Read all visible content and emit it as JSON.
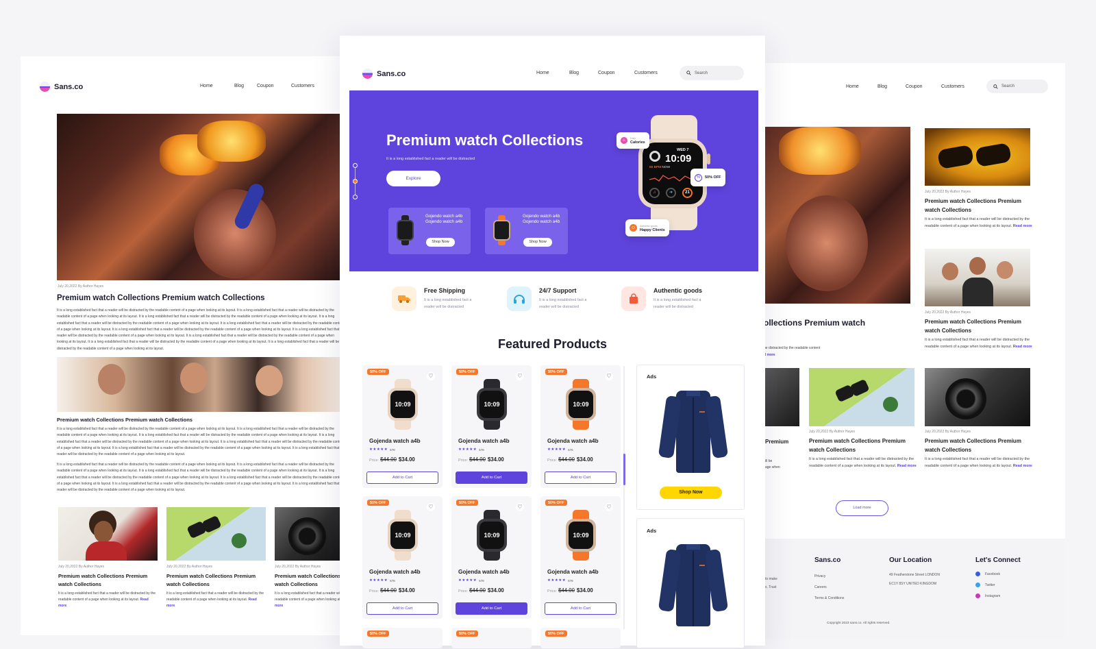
{
  "brand": {
    "name": "Sans.co"
  },
  "nav": {
    "home": "Home",
    "blog": "Blog",
    "coupon": "Coupon",
    "customers": "Customers",
    "search_placeholder": "Search"
  },
  "left": {
    "meta1": "July 20,2022   By Author Hayes",
    "title1": "Premium watch Collections Premium watch Collections",
    "para1": "It is a long established fact that a reader will be distracted by the readable content of a page when looking at its layout.  It is a long established fact that a reader will be distracted by the readable content of a page when looking at its layout.  It is a long established fact that a reader will be distracted by the readable content of a page when looking at its layout.  It is a long established fact that a reader will be distracted by the readable content of a page when looking at its layout. It is a long established fact that a reader will be distracted by the readable content of a page when looking at its layout.  It is a long established fact that a reader will be distracted by the readable content of a page when looking at its layout. It is a long established fact that a reader will be distracted by the readable content of a page when looking at its layout. It is a long established fact that a reader will be distracted by the readable content of a page when looking at its layout. It is a long established fact that a reader will be distracted by the readable content of a page when looking at its layout. It is a long established fact that a reader will be distracted by the readable content of a page when looking at its layout.",
    "subtitle": "Premium watch Collections Premium watch Collections",
    "para2": "It is a long established fact that a reader will be distracted by the readable content of a page when looking at its layout.  It is a long established fact that a reader will be distracted by the readable content of a page when looking at its layout.  It is a long established fact that a reader will be distracted by the readable content of a page when looking at its layout.  It is a long established fact that a reader will be distracted by the readable content of a page when looking at its layout. It is a long established fact that a reader will be distracted by the readable content of a page when looking at its layout.  It is a long established fact that a reader will be distracted by the readable content of a page when looking at its layout. It is a long established fact that a reader will be distracted by the readable content of a page when looking at its layout.",
    "para3": "It is a long established fact that a reader will be distracted by the readable content of a page when looking at its layout.  It is a long established fact that a reader will be distracted by the readable content of a page when looking at its layout.  It is a long established fact that a reader will be distracted by the readable content of a page when looking at its layout.  It is a long established fact that a reader will be distracted by the readable content of a page when looking at its layout. It is a long established fact that a reader will be distracted by the readable content of a page when looking at its layout.  It is a long established fact that a reader will be distracted by the readable content of a page when looking at its layout. It is a long established fact that a reader will be distracted by the readable content of a page when looking at its layout.",
    "cards": [
      {
        "meta": "July 20,2022   By Author Hayes",
        "title": "Premium watch Collections Premium watch Collections",
        "text": "It is a long established fact that a reader will be distracted by the readable content of a page when looking at its layout.",
        "more": "Read more"
      },
      {
        "meta": "July 20,2022   By Author Hayes",
        "title": "Premium watch Collections Premium watch Collections",
        "text": "It is a long established fact that a reader will be distracted by the readable content of a page when looking at its layout.",
        "more": "Read more"
      },
      {
        "meta": "July 20,2022   By Author Hayes",
        "title": "Premium watch Collections Premium watch Collections",
        "text": "It is a long established fact that a reader will be distracted by the readable content of a page when looking at its layout.",
        "more": "Read more"
      }
    ]
  },
  "hero": {
    "title": "Premium watch Collections",
    "subtitle": "It is a long established fact a reader will be distracted",
    "explore": "Explore",
    "mini": [
      {
        "text": "Gojendo watch a4b Gojendo watch a4b",
        "btn": "Shop Now"
      },
      {
        "text": "Gojendo watch a4b Gojendo watch a4b",
        "btn": "Shop Now"
      }
    ],
    "badge_calories_small": "Daily",
    "badge_calories": "Calories",
    "badge_off": "50% OFF",
    "badge_clients_small": "Authentic goods",
    "badge_clients": "Happy Clients",
    "watch": {
      "day": "WED 7",
      "time": "10:09",
      "bpm": "60 BPM",
      "now": "NOW",
      "num": "21"
    }
  },
  "features": [
    {
      "title": "Free Shipping",
      "text": "It is a long established fact a reader will be distracted"
    },
    {
      "title": "24/7 Support",
      "text": "It is a long established fact a reader will be distracted"
    },
    {
      "title": "Authentic goods",
      "text": "It is a long established fact a reader will be distracted"
    }
  ],
  "featured_title": "Featured Products",
  "products": [
    {
      "off": "50% OFF",
      "name": "Gojenda watch a4b",
      "stars": "★★★★★",
      "reviews": "578",
      "price_label": "Price:",
      "old": "$44.00",
      "new": "$34.00",
      "cta": "Add to Cart",
      "color": "cream",
      "filled": false
    },
    {
      "off": "50% OFF",
      "name": "Gojenda watch a4b",
      "stars": "★★★★★",
      "reviews": "578",
      "price_label": "Price:",
      "old": "$44.00",
      "new": "$34.00",
      "cta": "Add to Cart",
      "color": "black",
      "filled": true
    },
    {
      "off": "50% OFF",
      "name": "Gojenda watch a4b",
      "stars": "★★★★★",
      "reviews": "576",
      "price_label": "Price:",
      "old": "$44.00",
      "new": "$34.00",
      "cta": "Add to Cart",
      "color": "orange",
      "filled": false
    },
    {
      "off": "50% OFF",
      "name": "Gojenda watch a4b",
      "stars": "★★★★★",
      "reviews": "578",
      "price_label": "Price:",
      "old": "$44.00",
      "new": "$34.00",
      "cta": "Add to Cart",
      "color": "cream",
      "filled": false
    },
    {
      "off": "50% OFF",
      "name": "Gojenda watch a4b",
      "stars": "★★★★★",
      "reviews": "578",
      "price_label": "Price:",
      "old": "$44.00",
      "new": "$34.00",
      "cta": "Add to Cart",
      "color": "black",
      "filled": true
    },
    {
      "off": "50% OFF",
      "name": "Gojenda watch a4b",
      "stars": "★★★★★",
      "reviews": "578",
      "price_label": "Price:",
      "old": "$44.00",
      "new": "$34.00",
      "cta": "Add to Cart",
      "color": "orange",
      "filled": false
    }
  ],
  "bottom_offs": [
    "50% OFF",
    "50% OFF",
    "50% OFF"
  ],
  "ads": {
    "label": "Ads",
    "cta": "Shop Now",
    "label2": "Ads"
  },
  "right": {
    "big_title": "ollections Premium watch",
    "big_text": "be distracted by the readable content",
    "big_more": "d more",
    "side_cards": [
      {
        "meta": "July 20,2022   By Author Hayes",
        "title": "Premium watch Collections Premium watch Collections",
        "text": "It is a long established fact that a reader will be distracted by the readable content of a page when looking at its layout.",
        "more": "Read more"
      },
      {
        "meta": "July 20,2022   By Author Hayes",
        "title": "Premium watch Collections Premium watch Collections",
        "text": "It is a long established fact that a reader will be distracted by the readable content of a page when looking at its layout.",
        "more": "Read more"
      }
    ],
    "partial_title": "Premium",
    "partial_text1": "ill be",
    "partial_text2": "age when",
    "cards": [
      {
        "meta": "July 20,2022   By Author Hayes",
        "title": "Premium watch Collections Premium watch Collections",
        "text": "It is a long established fact that a reader will be distracted by the readable content of a page when looking at its layout.",
        "more": "Read more"
      },
      {
        "meta": "July 20,2022   By Author Hayes",
        "title": "Premium watch Collections Premium watch Collections",
        "text": "It is a long established fact that a reader will be distracted by the readable content of a page when looking at its layout.",
        "more": "Read more"
      }
    ],
    "load_more": "Load more",
    "footer": {
      "partial1": "to make",
      "partial2": "s. Trust",
      "brand": "Sans.co",
      "links": [
        "Privacy",
        "Careers",
        "Terms & Conditions"
      ],
      "location_title": "Our Location",
      "address1": "49 Featherstone Street  LONDON",
      "address2": "EC1Y 8SY  UNITED KINGDOM",
      "connect_title": "Let's Connect",
      "social": [
        "Facebook",
        "Twitter",
        "Instagram"
      ],
      "copyright": "Copyright 2023 sans.co. All rights reserved."
    }
  },
  "colors": {
    "accent": "#5e44dc",
    "orange": "#f4772a",
    "yellow": "#ffd600"
  }
}
